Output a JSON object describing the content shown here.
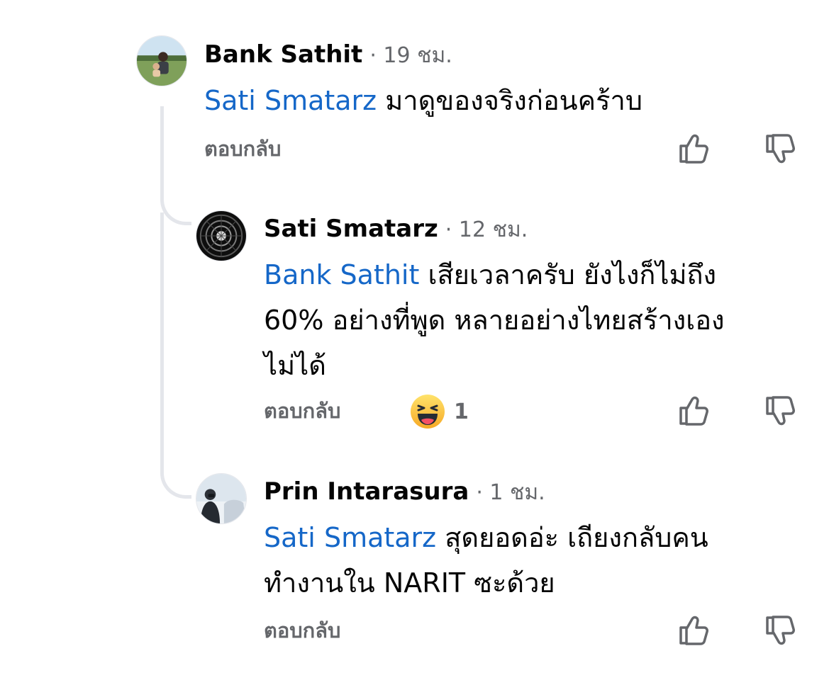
{
  "comments": [
    {
      "author": "Bank Sathit",
      "time": "· 19 ชม.",
      "mention": "Sati Smatarz",
      "text_lines": [
        " มาดูของจริงก่อนคร้าบ"
      ],
      "reply_label": "ตอบกลับ"
    },
    {
      "author": "Sati Smatarz",
      "time": "· 12 ชม.",
      "mention": "Bank Sathit",
      "text_lines": [
        " เสียเวลาครับ ยังไงก็ไม่ถึง",
        "60% อย่างที่พูด หลายอย่างไทยสร้างเอง",
        "ไม่ได้"
      ],
      "reply_label": "ตอบกลับ",
      "reaction": {
        "icon": "haha-emoji-icon",
        "count": "1"
      }
    },
    {
      "author": "Prin Intarasura",
      "time": "· 1 ชม.",
      "mention": "Sati Smatarz",
      "text_lines": [
        " สุดยอดอ่ะ เถียงกลับคน",
        "ทำงานใน NARIT ซะด้วย"
      ],
      "reply_label": "ตอบกลับ"
    }
  ],
  "icons": {
    "like": "thumbs-up-icon",
    "dislike": "thumbs-down-icon"
  },
  "colors": {
    "mention": "#1567c8",
    "muted": "#65676b",
    "thread_line": "#e4e6eb"
  }
}
